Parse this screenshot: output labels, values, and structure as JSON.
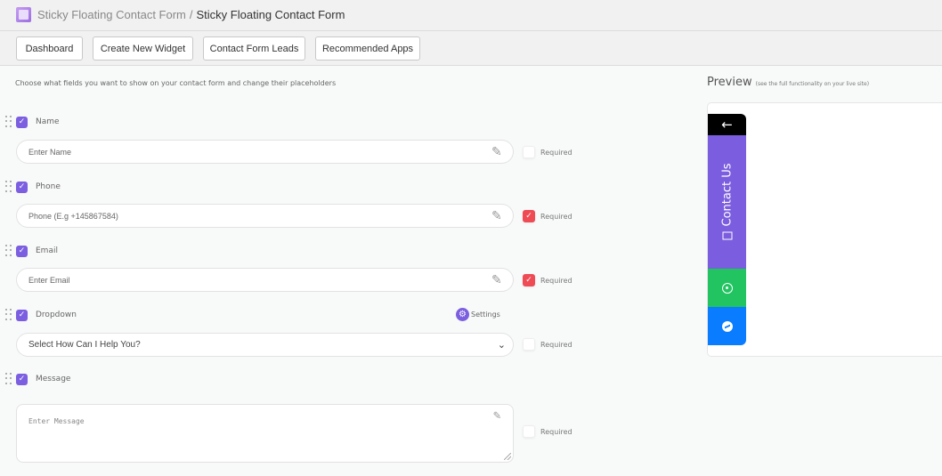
{
  "header": {
    "app_icon": "app-logo-icon",
    "breadcrumb_parent": "Sticky Floating Contact Form",
    "breadcrumb_separator": "/",
    "breadcrumb_current": "Sticky Floating Contact Form"
  },
  "nav": {
    "buttons": [
      "Dashboard",
      "Create New Widget",
      "Contact Form Leads",
      "Recommended Apps"
    ]
  },
  "form": {
    "intro": "Choose what fields you want to show on your contact form and change their placeholders",
    "required_label": "Required",
    "fields": [
      {
        "label": "Name",
        "enabled": true,
        "placeholder": "Enter Name",
        "required": false
      },
      {
        "label": "Phone",
        "enabled": true,
        "placeholder": "Phone (E.g +145867584)",
        "required": true
      },
      {
        "label": "Email",
        "enabled": true,
        "placeholder": "Enter Email",
        "required": true
      },
      {
        "label": "Dropdown",
        "enabled": true,
        "selected": "Select How Can I Help You?",
        "required": false,
        "settings_label": "Settings"
      },
      {
        "label": "Message",
        "enabled": true,
        "placeholder": "Enter Message",
        "required": false
      }
    ]
  },
  "preview": {
    "title": "Preview",
    "subtitle": "(see the full functionality on your live site)",
    "widget": {
      "close_icon": "←",
      "contact_label": "Contact Us",
      "colors": {
        "close": "#000000",
        "contact": "#7b5ddf",
        "whatsapp": "#21c461",
        "messenger": "#0a7cff"
      }
    }
  },
  "colors": {
    "accent": "#7b5fe0",
    "required_on": "#ef4b55"
  }
}
